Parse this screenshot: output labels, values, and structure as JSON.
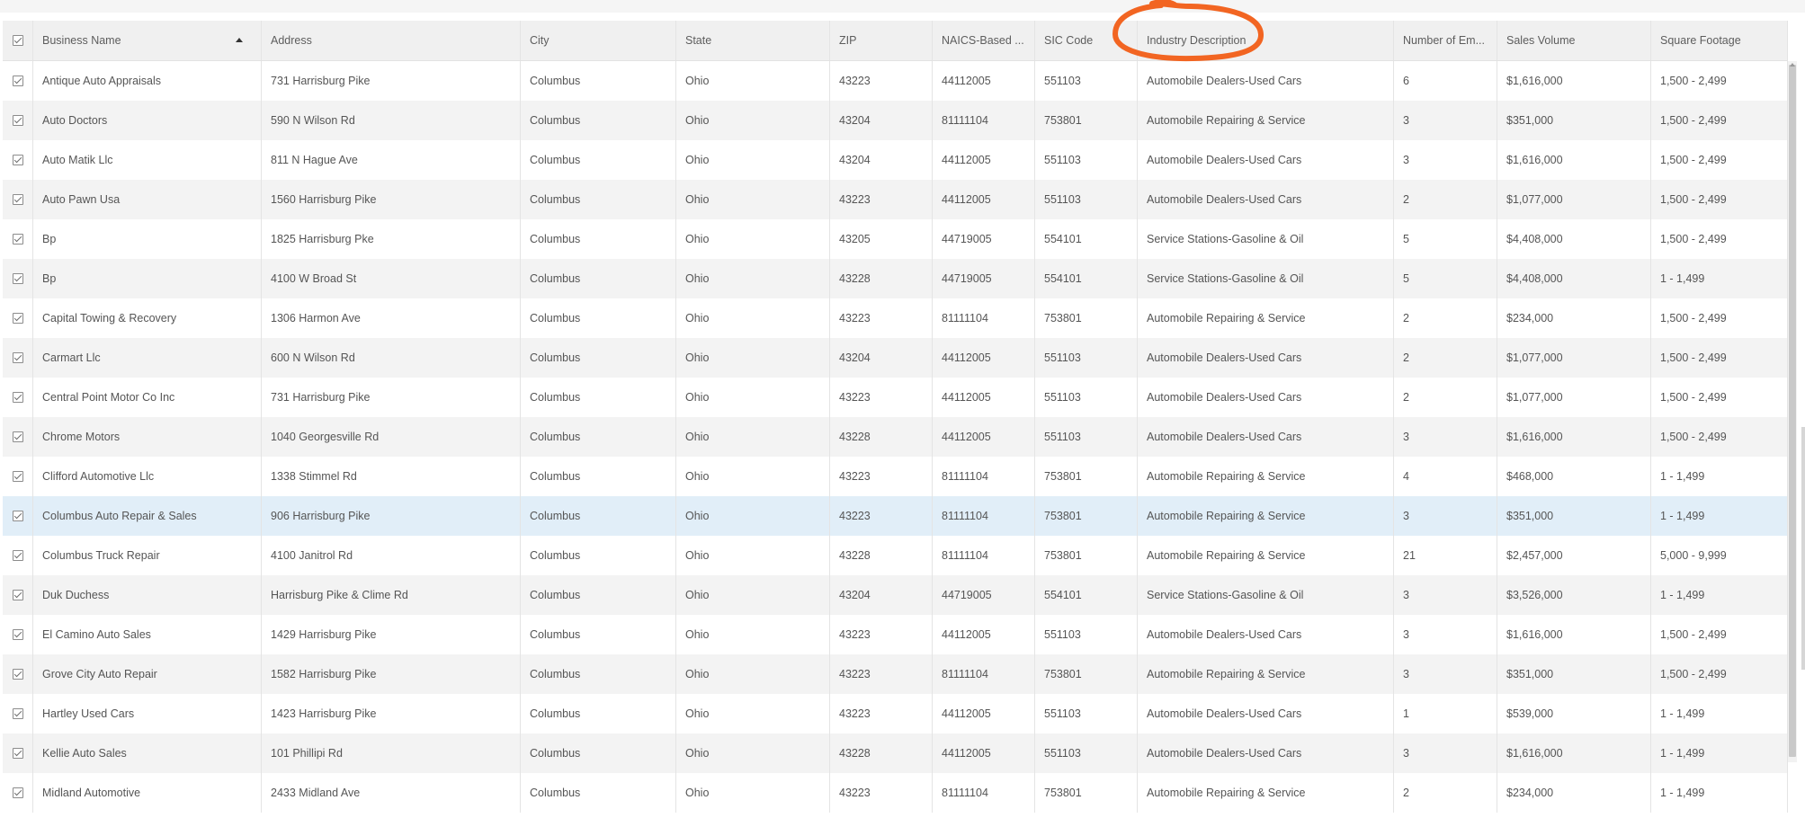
{
  "table": {
    "columns": [
      {
        "label": "Business Name"
      },
      {
        "label": "Address"
      },
      {
        "label": "City"
      },
      {
        "label": "State"
      },
      {
        "label": "ZIP"
      },
      {
        "label": "NAICS-Based ..."
      },
      {
        "label": "SIC Code"
      },
      {
        "label": "Industry Description"
      },
      {
        "label": "Number of Em..."
      },
      {
        "label": "Sales Volume"
      },
      {
        "label": "Square Footage"
      }
    ],
    "sort_column": "Business Name",
    "sort_direction": "ascending",
    "selected_row_index": 11,
    "rows": [
      [
        "Antique Auto Appraisals",
        "731 Harrisburg Pike",
        "Columbus",
        "Ohio",
        "43223",
        "44112005",
        "551103",
        "Automobile Dealers-Used Cars",
        "6",
        "$1,616,000",
        "1,500 - 2,499"
      ],
      [
        "Auto Doctors",
        "590 N Wilson Rd",
        "Columbus",
        "Ohio",
        "43204",
        "81111104",
        "753801",
        "Automobile Repairing & Service",
        "3",
        "$351,000",
        "1,500 - 2,499"
      ],
      [
        "Auto Matik Llc",
        "811 N Hague Ave",
        "Columbus",
        "Ohio",
        "43204",
        "44112005",
        "551103",
        "Automobile Dealers-Used Cars",
        "3",
        "$1,616,000",
        "1,500 - 2,499"
      ],
      [
        "Auto Pawn Usa",
        "1560 Harrisburg Pike",
        "Columbus",
        "Ohio",
        "43223",
        "44112005",
        "551103",
        "Automobile Dealers-Used Cars",
        "2",
        "$1,077,000",
        "1,500 - 2,499"
      ],
      [
        "Bp",
        "1825 Harrisburg Pke",
        "Columbus",
        "Ohio",
        "43205",
        "44719005",
        "554101",
        "Service Stations-Gasoline & Oil",
        "5",
        "$4,408,000",
        "1,500 - 2,499"
      ],
      [
        "Bp",
        "4100 W Broad St",
        "Columbus",
        "Ohio",
        "43228",
        "44719005",
        "554101",
        "Service Stations-Gasoline & Oil",
        "5",
        "$4,408,000",
        "1 - 1,499"
      ],
      [
        "Capital Towing & Recovery",
        "1306 Harmon Ave",
        "Columbus",
        "Ohio",
        "43223",
        "81111104",
        "753801",
        "Automobile Repairing & Service",
        "2",
        "$234,000",
        "1,500 - 2,499"
      ],
      [
        "Carmart Llc",
        "600 N Wilson Rd",
        "Columbus",
        "Ohio",
        "43204",
        "44112005",
        "551103",
        "Automobile Dealers-Used Cars",
        "2",
        "$1,077,000",
        "1,500 - 2,499"
      ],
      [
        "Central Point Motor Co Inc",
        "731 Harrisburg Pike",
        "Columbus",
        "Ohio",
        "43223",
        "44112005",
        "551103",
        "Automobile Dealers-Used Cars",
        "2",
        "$1,077,000",
        "1,500 - 2,499"
      ],
      [
        "Chrome Motors",
        "1040 Georgesville Rd",
        "Columbus",
        "Ohio",
        "43228",
        "44112005",
        "551103",
        "Automobile Dealers-Used Cars",
        "3",
        "$1,616,000",
        "1,500 - 2,499"
      ],
      [
        "Clifford Automotive Llc",
        "1338 Stimmel Rd",
        "Columbus",
        "Ohio",
        "43223",
        "81111104",
        "753801",
        "Automobile Repairing & Service",
        "4",
        "$468,000",
        "1 - 1,499"
      ],
      [
        "Columbus Auto Repair & Sales",
        "906 Harrisburg Pike",
        "Columbus",
        "Ohio",
        "43223",
        "81111104",
        "753801",
        "Automobile Repairing & Service",
        "3",
        "$351,000",
        "1 - 1,499"
      ],
      [
        "Columbus Truck Repair",
        "4100 Janitrol Rd",
        "Columbus",
        "Ohio",
        "43228",
        "81111104",
        "753801",
        "Automobile Repairing & Service",
        "21",
        "$2,457,000",
        "5,000 - 9,999"
      ],
      [
        "Duk Duchess",
        "Harrisburg Pike & Clime Rd",
        "Columbus",
        "Ohio",
        "43204",
        "44719005",
        "554101",
        "Service Stations-Gasoline & Oil",
        "3",
        "$3,526,000",
        "1 - 1,499"
      ],
      [
        "El Camino Auto Sales",
        "1429 Harrisburg Pike",
        "Columbus",
        "Ohio",
        "43223",
        "44112005",
        "551103",
        "Automobile Dealers-Used Cars",
        "3",
        "$1,616,000",
        "1,500 - 2,499"
      ],
      [
        "Grove City Auto Repair",
        "1582 Harrisburg Pike",
        "Columbus",
        "Ohio",
        "43223",
        "81111104",
        "753801",
        "Automobile Repairing & Service",
        "3",
        "$351,000",
        "1,500 - 2,499"
      ],
      [
        "Hartley Used Cars",
        "1423 Harrisburg Pike",
        "Columbus",
        "Ohio",
        "43223",
        "44112005",
        "551103",
        "Automobile Dealers-Used Cars",
        "1",
        "$539,000",
        "1 - 1,499"
      ],
      [
        "Kellie Auto Sales",
        "101 Phillipi Rd",
        "Columbus",
        "Ohio",
        "43228",
        "44112005",
        "551103",
        "Automobile Dealers-Used Cars",
        "3",
        "$1,616,000",
        "1 - 1,499"
      ],
      [
        "Midland Automotive",
        "2433 Midland Ave",
        "Columbus",
        "Ohio",
        "43223",
        "81111104",
        "753801",
        "Automobile Repairing & Service",
        "2",
        "$234,000",
        "1 - 1,499"
      ]
    ]
  },
  "colors": {
    "annotation": "#f26522",
    "selected_row": "#e1eef8",
    "header_bg": "#f0f0f0",
    "alt_row": "#f3f3f3"
  },
  "icons": {
    "select_all": "checkbox-checked-icon",
    "sort": "sort-ascending-icon",
    "row_select": "checkbox-checked-icon"
  }
}
